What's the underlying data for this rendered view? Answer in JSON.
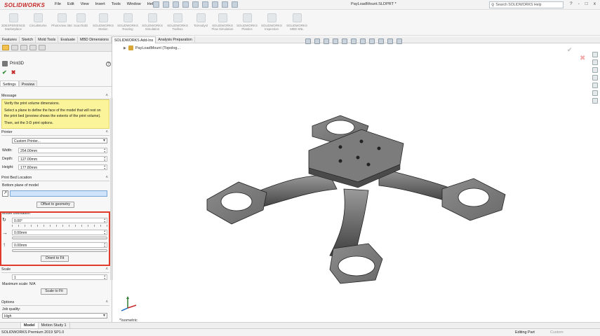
{
  "titlebar": {
    "brand": "SOLIDWORKS",
    "menus": [
      "File",
      "Edit",
      "View",
      "Insert",
      "Tools",
      "Window",
      "Help"
    ],
    "document_title": "PayLoadMount.SLDPRT *",
    "search_placeholder": "Search SOLIDWORKS Help",
    "window_controls": [
      "?",
      "-",
      "□",
      "x"
    ]
  },
  "ribbon": {
    "items": [
      {
        "label": "3DEXPERIENCE Marketplace",
        "icon": "marketplace-icon"
      },
      {
        "label": "CircuitWorks",
        "icon": "circuitworks-icon"
      },
      {
        "label": "PhotoView 360",
        "icon": "photoview-icon"
      },
      {
        "label": "ScanTo3D",
        "icon": "scanto3d-icon"
      },
      {
        "label": "SOLIDWORKS Motion",
        "icon": "motion-icon"
      },
      {
        "label": "SOLIDWORKS Routing",
        "icon": "routing-icon"
      },
      {
        "label": "SOLIDWORKS Simulation",
        "icon": "simulation-icon"
      },
      {
        "label": "SOLIDWORKS Toolbox",
        "icon": "toolbox-icon"
      },
      {
        "label": "TolAnalyst",
        "icon": "tolanalyst-icon"
      },
      {
        "label": "SOLIDWORKS Flow Simulation",
        "icon": "flow-simulation-icon"
      },
      {
        "label": "SOLIDWORKS Plastics",
        "icon": "plastics-icon"
      },
      {
        "label": "SOLIDWORKS Inspection",
        "icon": "inspection-icon"
      },
      {
        "label": "SOLIDWORKS MBD SNL",
        "icon": "mbd-snl-icon"
      }
    ]
  },
  "tabs": [
    "Features",
    "Sketch",
    "Mold Tools",
    "Evaluate",
    "MBD Dimensions",
    "SOLIDWORKS Add-Ins",
    "Analysis Preparation"
  ],
  "active_tab": "SOLIDWORKS Add-Ins",
  "property_manager": {
    "title": "Print3D",
    "help": "?",
    "subtabs": [
      "Settings",
      "Preview"
    ],
    "message": {
      "header": "Message",
      "line1": "Verify the print volume dimensions.",
      "line2": "Select a plane to define the face of the model that will rest on the print bed (preview shows the extents of the print volume).",
      "line3": "Then, set the 3-D print options."
    },
    "printer": {
      "header": "Printer",
      "selected": "Custom Printer...",
      "width_label": "Width:",
      "width_value": "254.00mm",
      "depth_label": "Depth:",
      "depth_value": "127.00mm",
      "height_label": "Height:",
      "height_value": "177.80mm"
    },
    "print_bed": {
      "header": "Print Bed Location",
      "subheader": "Bottom plane of model",
      "offset_button": "Offset to geometry"
    },
    "orientation": {
      "header": "Model orientation",
      "rotation_value": "0.00°",
      "x_value": "0.00mm",
      "y_value": "0.00mm",
      "orient_button": "Orient to Fit"
    },
    "scale": {
      "header": "Scale",
      "value": "1",
      "max_label": "Maximum scale: N/A",
      "button": "Scale to Fit"
    },
    "options": {
      "header": "Options",
      "quality_label": "Job quality:",
      "quality_value": "High"
    }
  },
  "viewport": {
    "tree_item": "PayLoadMount (Topolog...",
    "view_label": "*Isometric"
  },
  "bottom_tabs": [
    "Model",
    "Motion Study 1"
  ],
  "status": {
    "left": "SOLIDWORKS Premium 2019 SP1.0",
    "mode": "Editing Part",
    "units": "Custom"
  },
  "colors": {
    "accent_red": "#e03b2b",
    "message_bg": "#fbf49a",
    "brand_red": "#c62828"
  }
}
